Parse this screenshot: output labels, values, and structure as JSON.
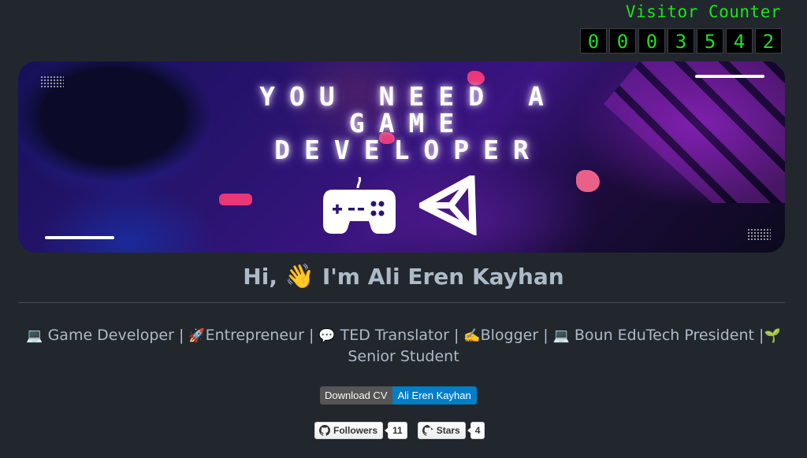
{
  "visitor_counter": {
    "title": "Visitor Counter",
    "digits": [
      "0",
      "0",
      "0",
      "3",
      "5",
      "4",
      "2"
    ]
  },
  "banner": {
    "title_lines": [
      "YOU NEED A",
      "GAME",
      "DEVELOPER"
    ],
    "icons": [
      "gamepad-icon",
      "unity-logo-icon"
    ]
  },
  "headline": {
    "prefix": "Hi,",
    "emoji": "👋",
    "text": "I'm Ali Eren Kayhan"
  },
  "bio": {
    "items": [
      {
        "emoji": "💻",
        "label": "Game Developer"
      },
      {
        "emoji": "🚀",
        "label": "Entrepreneur"
      },
      {
        "emoji": "💬",
        "label": "TED Translator"
      },
      {
        "emoji": "✍️",
        "label": "Blogger"
      },
      {
        "emoji": "💻",
        "label": "Boun EduTech President"
      },
      {
        "emoji": "🌱",
        "label": "Senior Student"
      }
    ],
    "separator": "|"
  },
  "cv_badge": {
    "left": "Download CV",
    "right": "Ali Eren Kayhan",
    "left_color": "#555555",
    "right_color": "#007ec6"
  },
  "github_badges": {
    "followers": {
      "label": "Followers",
      "count": "11"
    },
    "stars": {
      "label": "Stars",
      "count": "4"
    }
  }
}
